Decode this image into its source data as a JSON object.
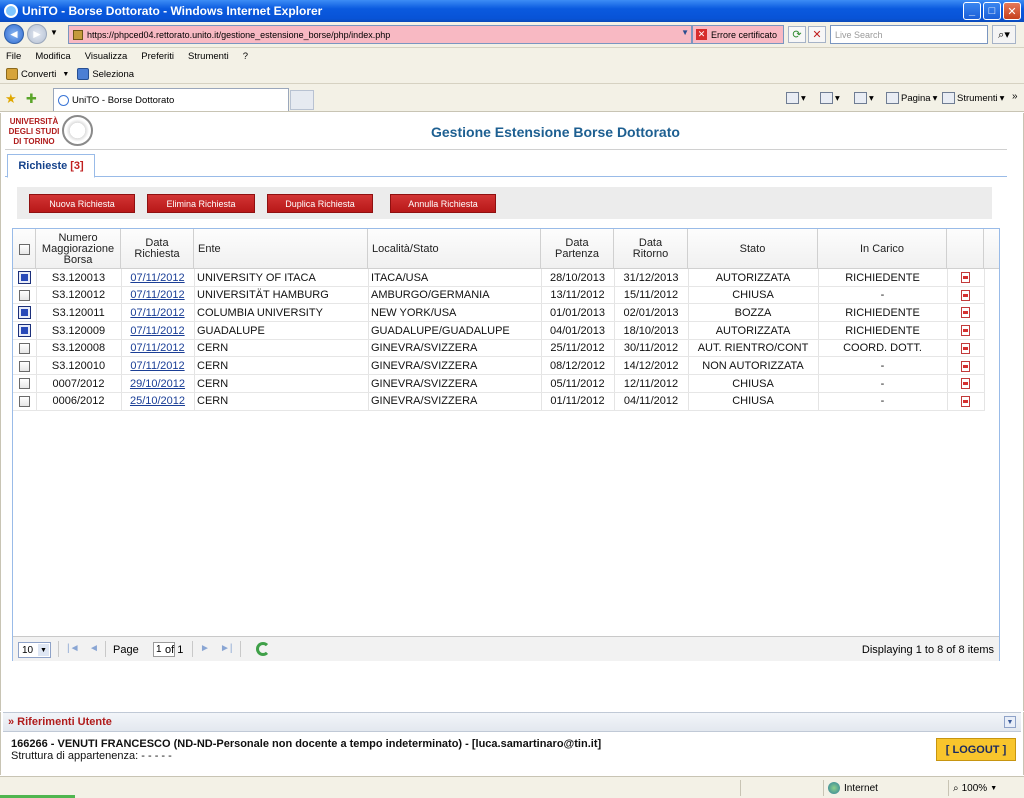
{
  "browser": {
    "title": "UniTO - Borse Dottorato - Windows Internet Explorer",
    "url": "https://phpced04.rettorato.unito.it/gestione_estensione_borse/php/index.php",
    "cert_error": "Errore certificato",
    "search_placeholder": "Live Search",
    "menu": [
      "File",
      "Modifica",
      "Visualizza",
      "Preferiti",
      "Strumenti",
      "?"
    ],
    "links": {
      "converti": "Converti",
      "seleziona": "Seleziona"
    },
    "tab_title": "UniTO - Borse Dottorato",
    "commands": {
      "pagina": "Pagina",
      "strumenti": "Strumenti"
    },
    "status": {
      "zone": "Internet",
      "zoom": "100%"
    }
  },
  "header": {
    "logo_line1": "UNIVERSITÀ",
    "logo_line2": "DEGLI STUDI",
    "logo_line3": "DI TORINO",
    "app_title": "Gestione Estensione Borse Dottorato"
  },
  "tab": {
    "label": "Richieste",
    "count": "[3]"
  },
  "toolbar": {
    "nuova": "Nuova Richiesta",
    "elimina": "Elimina Richiesta",
    "duplica": "Duplica Richiesta",
    "annulla": "Annulla Richiesta"
  },
  "grid": {
    "columns": {
      "numero_l1": "Numero",
      "numero_l2": "Maggiorazione",
      "numero_l3": "Borsa",
      "data_l1": "Data",
      "data_l2": "Richiesta",
      "ente": "Ente",
      "localita": "Località/Stato",
      "partenza_l1": "Data",
      "partenza_l2": "Partenza",
      "ritorno_l1": "Data",
      "ritorno_l2": "Ritorno",
      "stato": "Stato",
      "incarico": "In Carico"
    },
    "rows": [
      {
        "selected": true,
        "numero": "S3.120013",
        "data": "07/11/2012",
        "ente": "UNIVERSITY OF ITACA",
        "localita": "ITACA/USA",
        "partenza": "28/10/2013",
        "ritorno": "31/12/2013",
        "stato": "AUTORIZZATA",
        "incarico": "RICHIEDENTE"
      },
      {
        "selected": false,
        "numero": "S3.120012",
        "data": "07/11/2012",
        "ente": "UNIVERSITÄT HAMBURG",
        "localita": "AMBURGO/GERMANIA",
        "partenza": "13/11/2012",
        "ritorno": "15/11/2012",
        "stato": "CHIUSA",
        "incarico": "-"
      },
      {
        "selected": true,
        "numero": "S3.120011",
        "data": "07/11/2012",
        "ente": "COLUMBIA UNIVERSITY",
        "localita": "NEW YORK/USA",
        "partenza": "01/01/2013",
        "ritorno": "02/01/2013",
        "stato": "BOZZA",
        "incarico": "RICHIEDENTE"
      },
      {
        "selected": true,
        "numero": "S3.120009",
        "data": "07/11/2012",
        "ente": "GUADALUPE",
        "localita": "GUADALUPE/GUADALUPE",
        "partenza": "04/01/2013",
        "ritorno": "18/10/2013",
        "stato": "AUTORIZZATA",
        "incarico": "RICHIEDENTE"
      },
      {
        "selected": false,
        "numero": "S3.120008",
        "data": "07/11/2012",
        "ente": "CERN",
        "localita": "GINEVRA/SVIZZERA",
        "partenza": "25/11/2012",
        "ritorno": "30/11/2012",
        "stato": "AUT. RIENTRO/CONT",
        "incarico": "COORD. DOTT."
      },
      {
        "selected": false,
        "numero": "S3.120010",
        "data": "07/11/2012",
        "ente": "CERN",
        "localita": "GINEVRA/SVIZZERA",
        "partenza": "08/12/2012",
        "ritorno": "14/12/2012",
        "stato": "NON AUTORIZZATA",
        "incarico": "-"
      },
      {
        "selected": false,
        "numero": "0007/2012",
        "data": "29/10/2012",
        "ente": "CERN",
        "localita": "GINEVRA/SVIZZERA",
        "partenza": "05/11/2012",
        "ritorno": "12/11/2012",
        "stato": "CHIUSA",
        "incarico": "-"
      },
      {
        "selected": false,
        "numero": "0006/2012",
        "data": "25/10/2012",
        "ente": "CERN",
        "localita": "GINEVRA/SVIZZERA",
        "partenza": "01/11/2012",
        "ritorno": "04/11/2012",
        "stato": "CHIUSA",
        "incarico": "-"
      }
    ]
  },
  "pager": {
    "page_size": "10",
    "page_label": "Page",
    "page_value": "1",
    "of_label": "of 1",
    "display": "Displaying 1 to 8 of 8 items"
  },
  "user_panel": {
    "title": "» Riferimenti Utente",
    "line1": "166266 - VENUTI FRANCESCO  (ND-ND-Personale non docente a tempo indeterminato) - [luca.samartinaro@tin.it]",
    "line2": "Struttura di appartenenza: - - - - -",
    "logout": "[ LOGOUT ]"
  }
}
